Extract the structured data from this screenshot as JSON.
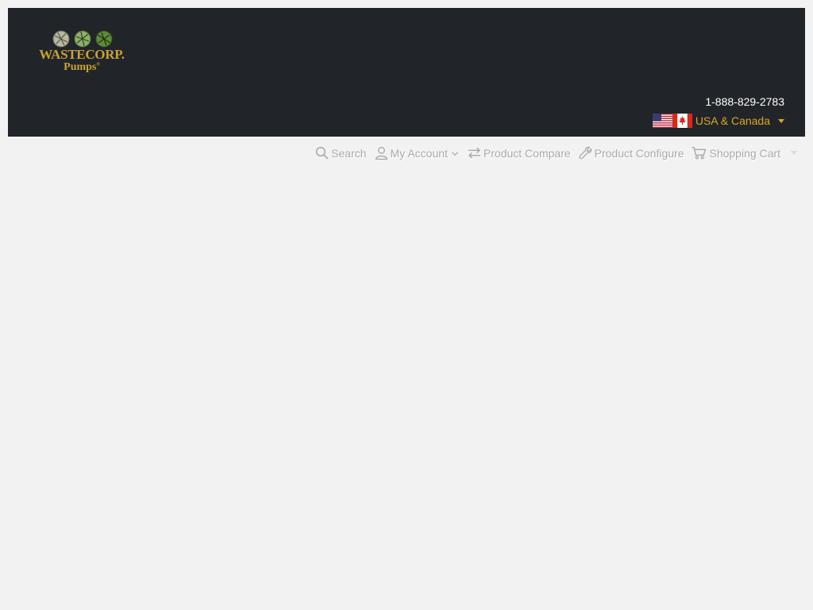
{
  "header": {
    "logo": {
      "line1": "WASTECORP.",
      "line2": "Pumps",
      "mark": "®",
      "colors": {
        "gold": "#c9a233",
        "green": "#5f8a3c",
        "ball": "#b8b8a0"
      }
    },
    "phone": "1-888-829-2783",
    "region": {
      "label": "USA & Canada",
      "flags": [
        "us-flag-icon",
        "canada-flag-icon"
      ]
    },
    "background": "#212429"
  },
  "nav": {
    "items": [
      {
        "label": "Search",
        "icon": "search-icon"
      },
      {
        "label": "My Account",
        "icon": "user-icon"
      },
      {
        "label": "Product Compare",
        "icon": "exchange-icon"
      },
      {
        "label": "Product Configure",
        "icon": "wrench-icon"
      },
      {
        "label": "Shopping Cart",
        "icon": "cart-icon"
      }
    ]
  },
  "colors": {
    "page_bg": "#f2f2f2",
    "accent": "#d8a826",
    "nav_text": "#a5a9ad"
  }
}
